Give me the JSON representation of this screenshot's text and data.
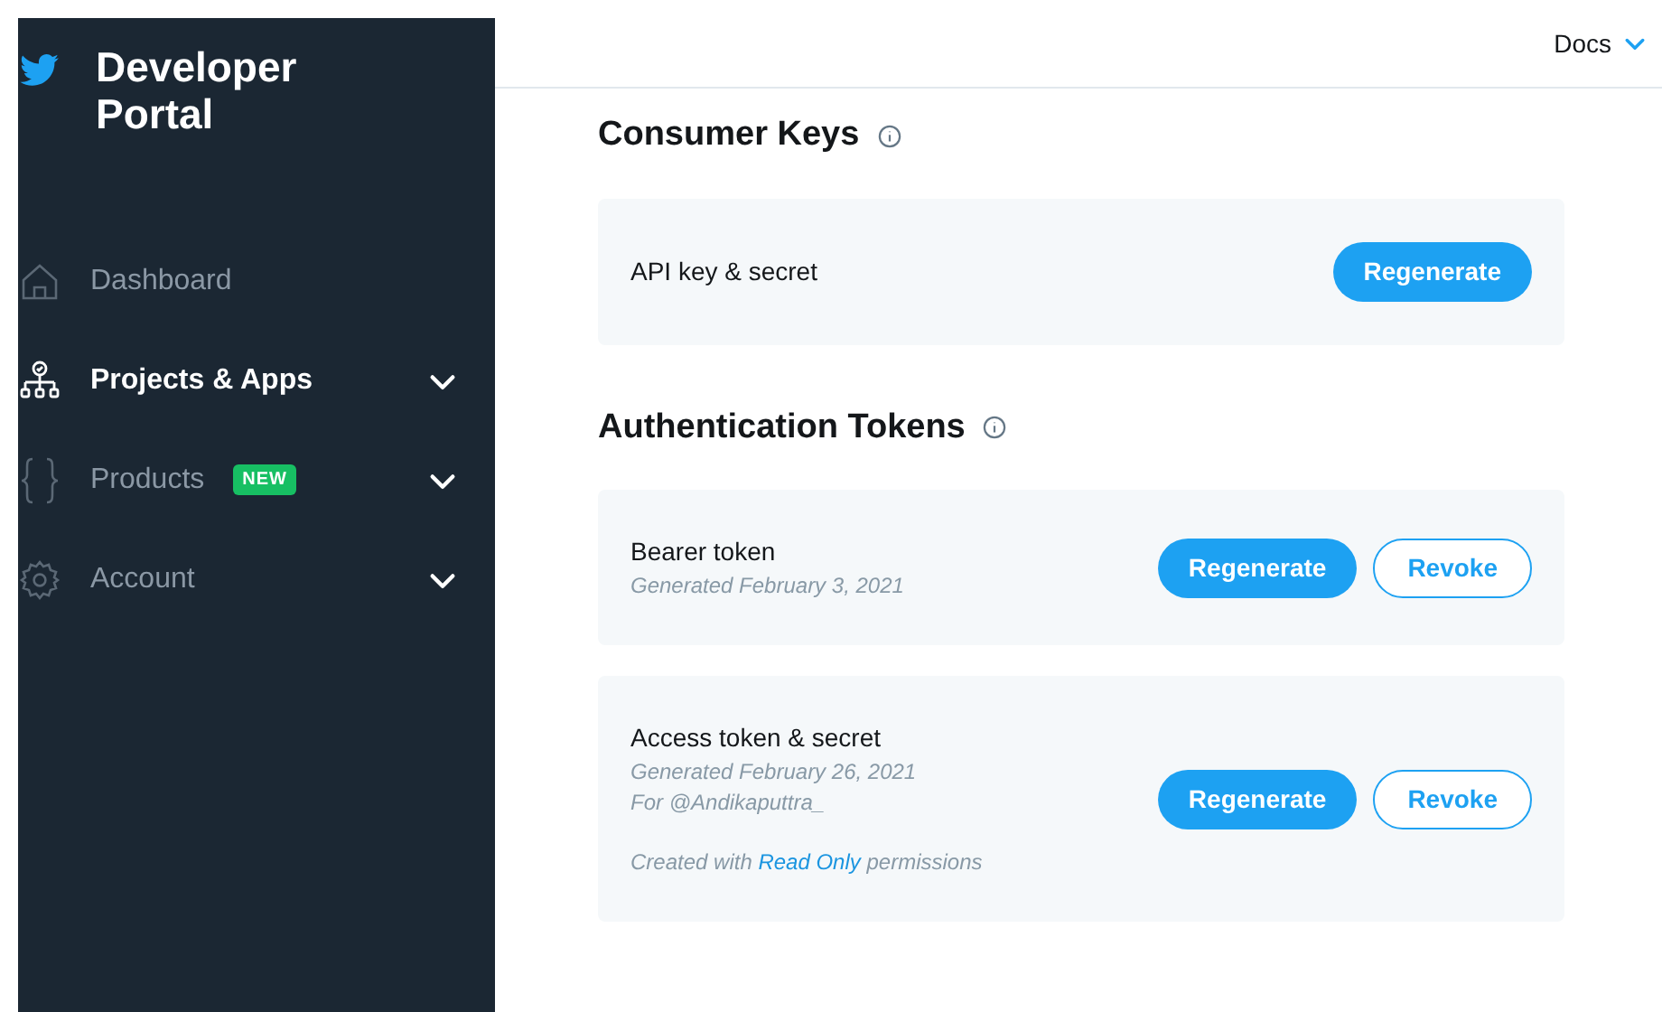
{
  "sidebar": {
    "title": "Developer Portal",
    "items": [
      {
        "label": "Dashboard",
        "selected": false,
        "expandable": false
      },
      {
        "label": "Projects & Apps",
        "selected": true,
        "expandable": true
      },
      {
        "label": "Products",
        "selected": false,
        "expandable": true,
        "badge": "NEW"
      },
      {
        "label": "Account",
        "selected": false,
        "expandable": true
      }
    ]
  },
  "header": {
    "menu": "Docs"
  },
  "sections": [
    {
      "title": "Consumer Keys",
      "cards": [
        {
          "title": "API key & secret",
          "buttons": [
            {
              "label": "Regenerate",
              "kind": "primary"
            }
          ]
        }
      ]
    },
    {
      "title": "Authentication Tokens",
      "cards": [
        {
          "title": "Bearer token",
          "details": [
            "Generated February 3, 2021"
          ],
          "buttons": [
            {
              "label": "Regenerate",
              "kind": "primary"
            },
            {
              "label": "Revoke",
              "kind": "outline"
            }
          ]
        },
        {
          "title": "Access token & secret",
          "details": [
            "Generated February 26, 2021",
            "For @Andikaputtra_"
          ],
          "note": {
            "before": "Created with ",
            "link": "Read Only",
            "after": " permissions"
          },
          "buttons": [
            {
              "label": "Regenerate",
              "kind": "primary"
            },
            {
              "label": "Revoke",
              "kind": "outline"
            }
          ]
        }
      ]
    }
  ]
}
